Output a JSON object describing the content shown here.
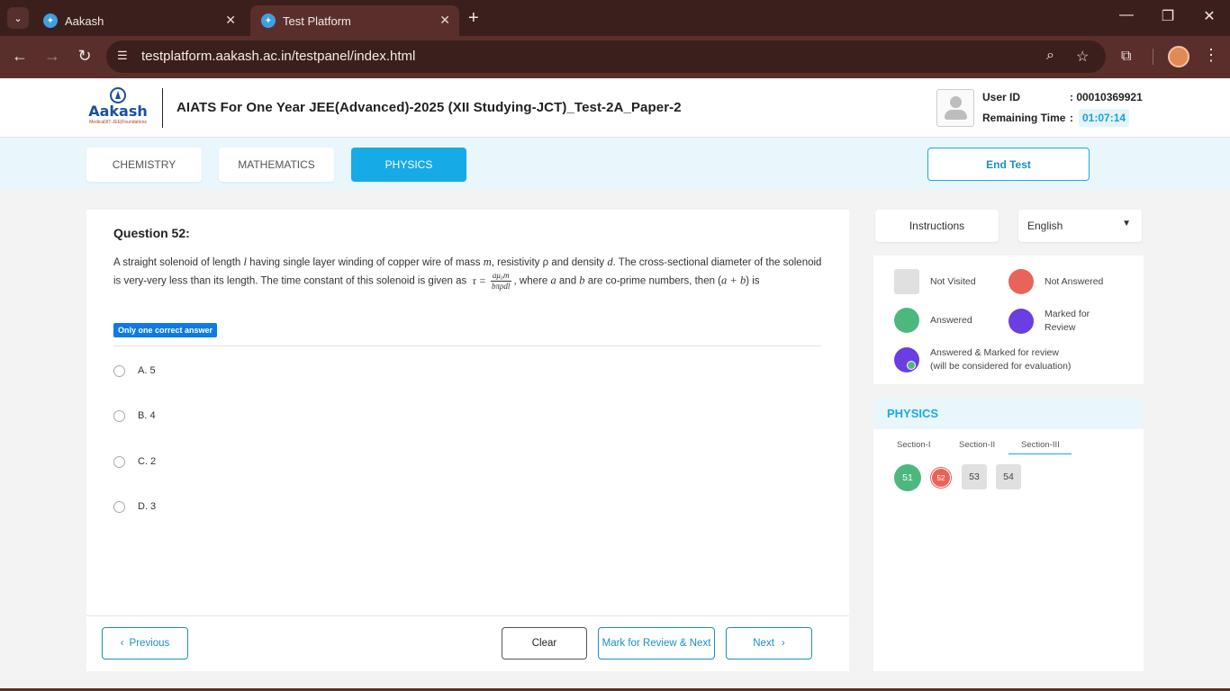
{
  "browser": {
    "tabs": [
      {
        "title": "Aakash",
        "active": false
      },
      {
        "title": "Test Platform",
        "active": true
      }
    ],
    "url": "testplatform.aakash.ac.in/testpanel/index.html"
  },
  "header": {
    "logo_text": "Aakash",
    "logo_sub": "Medical|IIT-JEE|Foundations",
    "test_title": "AIATS For One Year JEE(Advanced)-2025 (XII Studying-JCT)_Test-2A_Paper-2",
    "user_id_label": "User ID",
    "user_id_value": ": 00010369921",
    "remaining_label": "Remaining Time",
    "remaining_colon": ":",
    "remaining_value": "01:07:14"
  },
  "subjects": {
    "tabs": [
      "CHEMISTRY",
      "MATHEMATICS",
      "PHYSICS"
    ],
    "active": "PHYSICS",
    "end_test": "End Test"
  },
  "question": {
    "title": "Question 52:",
    "text_1": "A straight solenoid of length ",
    "var_l": "l",
    "text_2": " having single layer winding of copper wire of mass ",
    "var_m": "m",
    "text_3": ", resistivity ρ and density ",
    "var_d": "d",
    "text_4": ". The cross-sectional diameter of the solenoid is very-very less than its length. The time constant of this solenoid is given as",
    "formula_lhs": "τ =",
    "formula_num": "aμ₀m",
    "formula_den": "bπρdl",
    "text_5": ", where ",
    "var_a": "a",
    "text_6": " and ",
    "var_b": "b",
    "text_7": " are co-prime numbers, then (",
    "var_ab": "a + b",
    "text_8": ") is",
    "badge": "Only one correct answer",
    "options": [
      "A. 5",
      "B. 4",
      "C. 2",
      "D. 3"
    ]
  },
  "footer": {
    "previous": "Previous",
    "clear": "Clear",
    "mark_review": "Mark for Review & Next",
    "next": "Next"
  },
  "sidebar": {
    "instructions": "Instructions",
    "language": "English",
    "legend": {
      "not_visited": "Not Visited",
      "not_answered": "Not Answered",
      "answered": "Answered",
      "marked_review_1": "Marked for",
      "marked_review_2": "Review",
      "ans_marked_1": "Answered & Marked for review",
      "ans_marked_2": "(will be considered for evaluation)"
    },
    "palette": {
      "title": "PHYSICS",
      "sections": [
        "Section-I",
        "Section-II",
        "Section-III"
      ],
      "active_section": "Section-III",
      "questions": [
        {
          "num": "51",
          "status": "answered"
        },
        {
          "num": "52",
          "status": "not-answered"
        },
        {
          "num": "53",
          "status": "not-visited"
        },
        {
          "num": "54",
          "status": "not-visited"
        }
      ]
    }
  },
  "colors": {
    "accent": "#16aae7",
    "answered": "#4db87e",
    "not_answered": "#e8645a",
    "marked": "#6a3ee0",
    "not_visited": "#e0e0e0"
  }
}
